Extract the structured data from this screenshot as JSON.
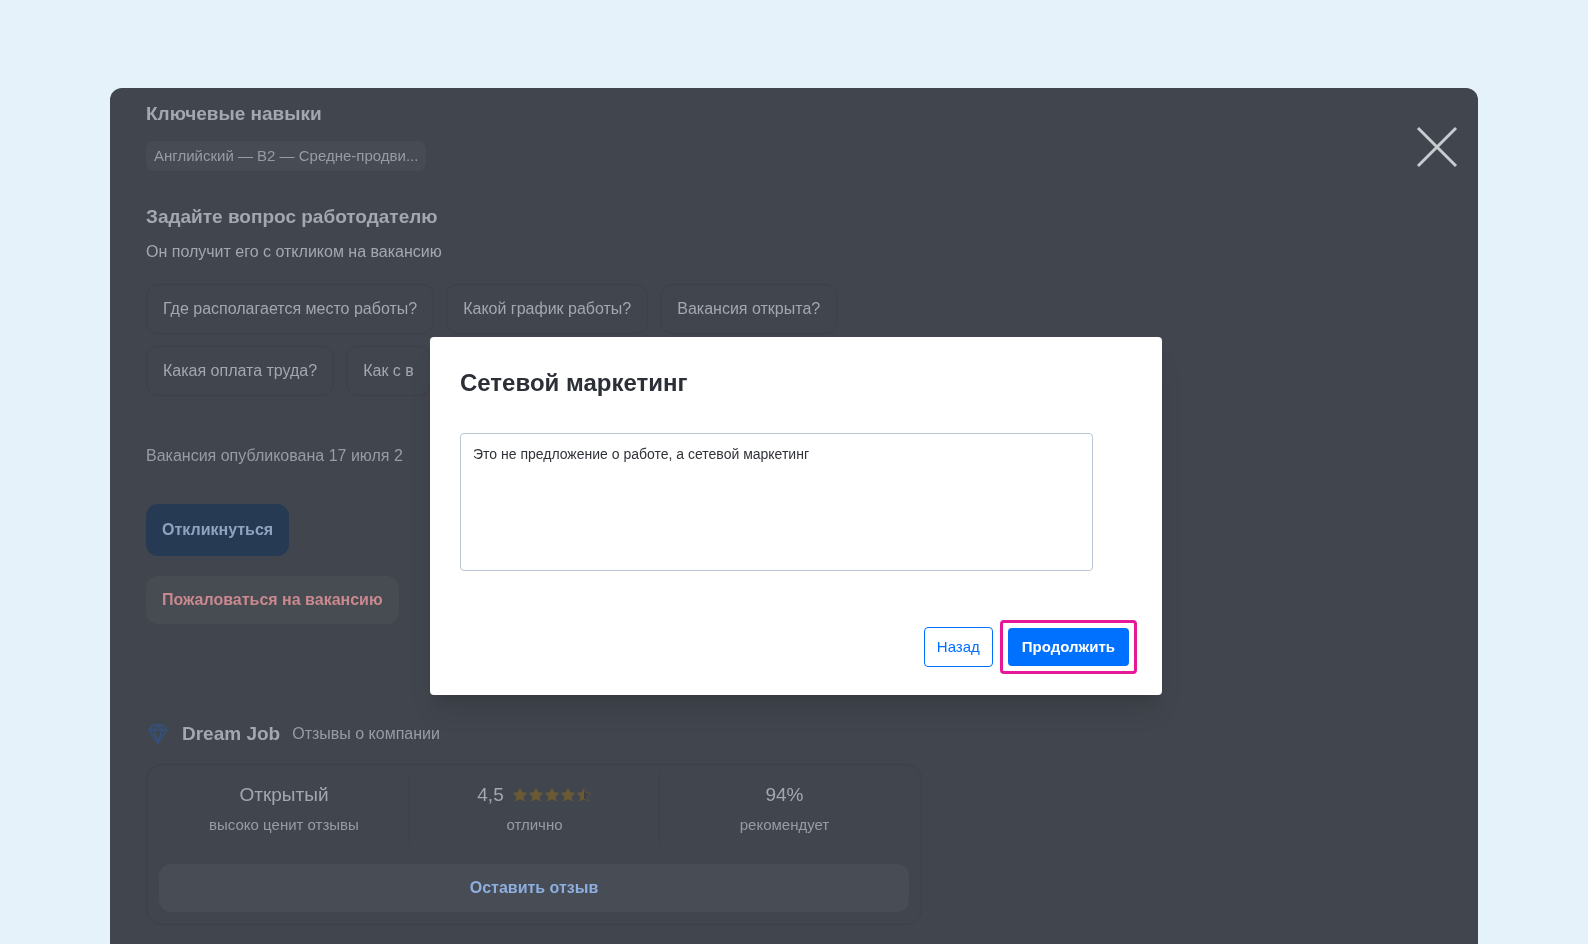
{
  "skills": {
    "title": "Ключевые навыки",
    "items": [
      "Английский — B2 — Средне-продви..."
    ]
  },
  "question": {
    "title": "Задайте вопрос работодателю",
    "subtitle": "Он получит его с откликом на вакансию",
    "chips": [
      [
        "Где располагается место работы?",
        "Какой график работы?",
        "Вакансия открыта?"
      ],
      [
        "Какая оплата труда?",
        "Как с в"
      ]
    ]
  },
  "published": "Вакансия опубликована 17 июля 2",
  "respond_button": "Откликнуться",
  "report_button": "Пожаловаться на вакансию",
  "company": {
    "name": "Dream Job",
    "link": "Отзывы о компании",
    "stats": [
      {
        "kind": "text",
        "value": "Открытый",
        "caption": "высоко ценит отзывы"
      },
      {
        "kind": "rating",
        "value": "4,5",
        "stars": 4.5,
        "caption": "отлично"
      },
      {
        "kind": "text",
        "value": "94%",
        "caption": "рекомендует"
      }
    ],
    "review_button": "Оставить отзыв"
  },
  "dialog": {
    "title": "Сетевой маркетинг",
    "text": "Это не предложение о работе, а сетевой маркетинг",
    "back_button": "Назад",
    "continue_button": "Продолжить",
    "continue_highlighted": true
  }
}
